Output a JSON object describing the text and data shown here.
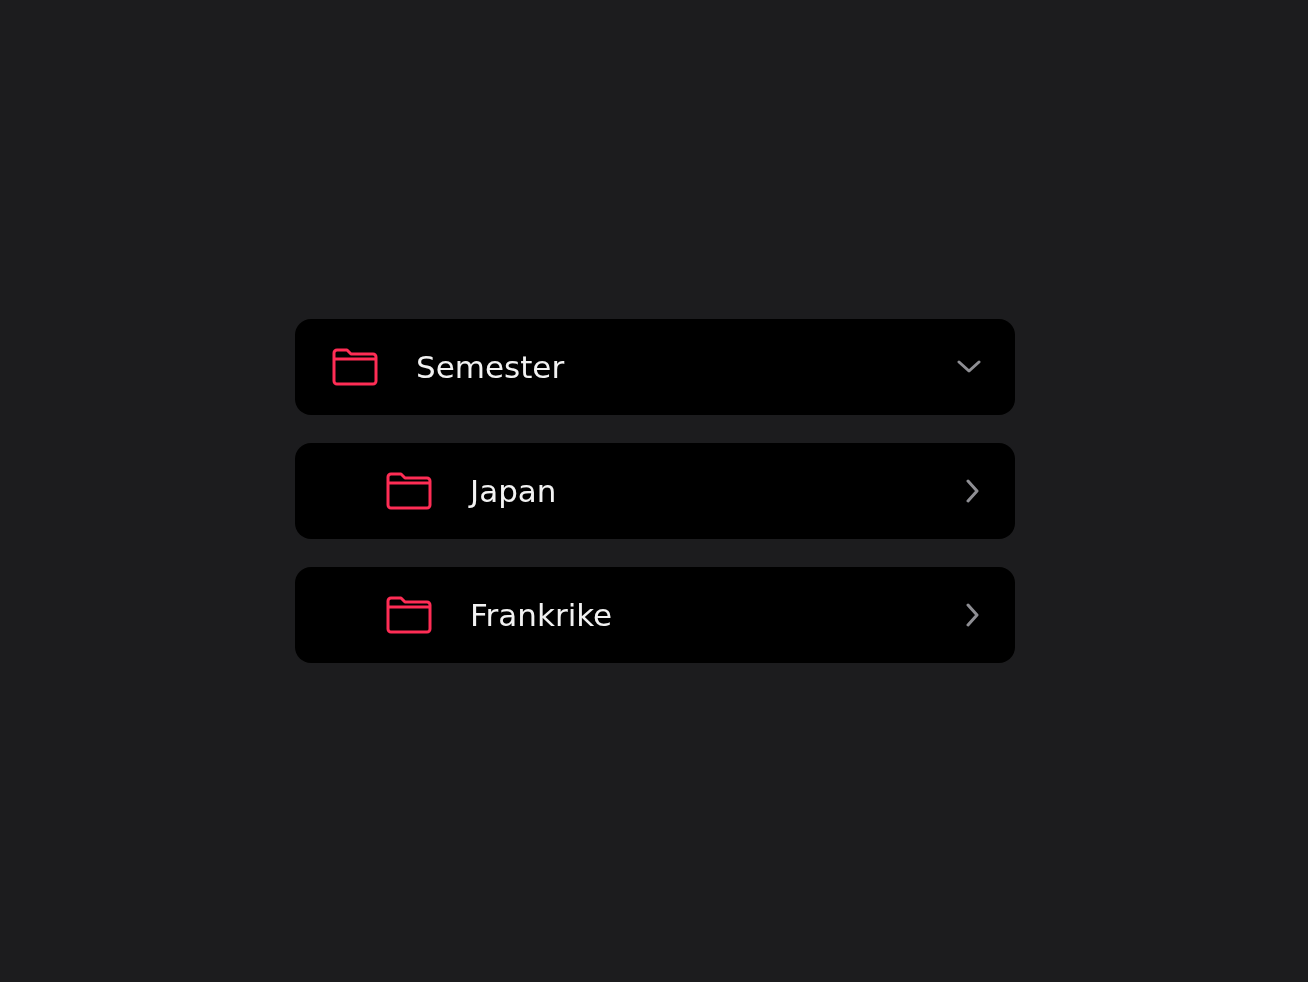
{
  "folders": [
    {
      "name": "Semester",
      "expanded": true,
      "children": [
        {
          "name": "Japan",
          "expanded": false
        },
        {
          "name": "Frankrike",
          "expanded": false
        }
      ]
    }
  ]
}
